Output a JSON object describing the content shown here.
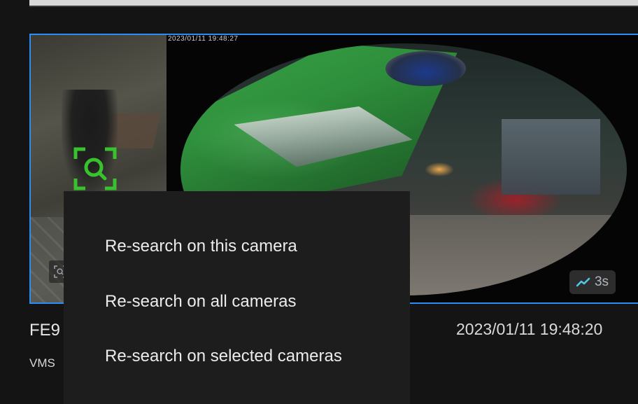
{
  "card": {
    "overlay_timestamp": "2023/01/11 19:48:27",
    "speed_badge": "3s",
    "accent_color": "#2e8cf5",
    "detect_icon": "search-focus-icon",
    "detect_icon_color": "#38c22e"
  },
  "camera": {
    "name": "FE9",
    "subtitle": "VMS"
  },
  "event_time": "2023/01/11 19:48:20",
  "context_menu": {
    "items": [
      "Re-search on this camera",
      "Re-search on all cameras",
      "Re-search on selected cameras"
    ]
  }
}
